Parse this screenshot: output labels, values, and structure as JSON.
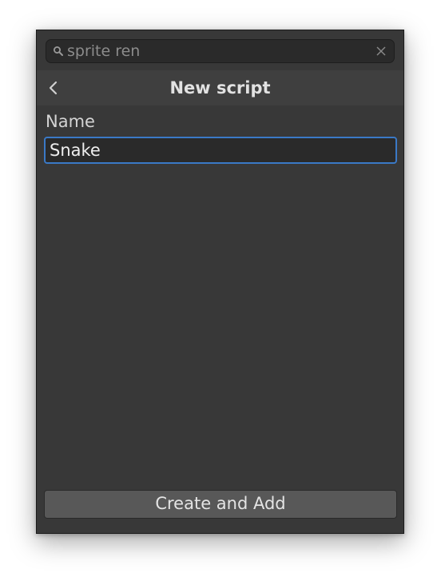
{
  "search": {
    "value": "sprite ren",
    "icon": "search-icon",
    "clear_icon": "close-icon"
  },
  "header": {
    "back_icon": "chevron-left-icon",
    "title": "New script"
  },
  "form": {
    "name_label": "Name",
    "name_value": "Snake"
  },
  "actions": {
    "create_label": "Create and Add"
  },
  "colors": {
    "panel_background": "#383838",
    "header_background": "#3f3f3f",
    "field_background": "#2a2a2a",
    "focus_border": "#3a79c6",
    "button_background": "#585858"
  }
}
